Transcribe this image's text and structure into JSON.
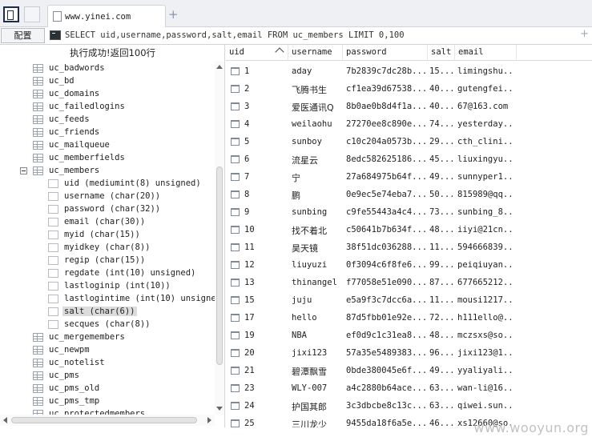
{
  "tabbar": {
    "tab_title": "www.yinei.com",
    "new_tab_symbol": "+"
  },
  "toolbar": {
    "config_label": "配置",
    "sql": "SELECT uid,username,password,salt,email FROM uc_members LIMIT 0,100",
    "corner_symbol": "+"
  },
  "left_panel": {
    "status": "执行成功!返回100行",
    "tree": [
      {
        "label": "uc_badwords",
        "level": 0,
        "kind": "table"
      },
      {
        "label": "uc_bd",
        "level": 0,
        "kind": "table"
      },
      {
        "label": "uc_domains",
        "level": 0,
        "kind": "table"
      },
      {
        "label": "uc_failedlogins",
        "level": 0,
        "kind": "table"
      },
      {
        "label": "uc_feeds",
        "level": 0,
        "kind": "table"
      },
      {
        "label": "uc_friends",
        "level": 0,
        "kind": "table"
      },
      {
        "label": "uc_mailqueue",
        "level": 0,
        "kind": "table"
      },
      {
        "label": "uc_memberfields",
        "level": 0,
        "kind": "table"
      },
      {
        "label": "uc_members",
        "level": 0,
        "kind": "table",
        "expanded": true
      },
      {
        "label": "uid (mediumint(8) unsigned)",
        "level": 1,
        "kind": "column"
      },
      {
        "label": "username (char(20))",
        "level": 1,
        "kind": "column"
      },
      {
        "label": "password (char(32))",
        "level": 1,
        "kind": "column"
      },
      {
        "label": "email (char(30))",
        "level": 1,
        "kind": "column"
      },
      {
        "label": "myid (char(15))",
        "level": 1,
        "kind": "column"
      },
      {
        "label": "myidkey (char(8))",
        "level": 1,
        "kind": "column"
      },
      {
        "label": "regip (char(15))",
        "level": 1,
        "kind": "column"
      },
      {
        "label": "regdate (int(10) unsigned)",
        "level": 1,
        "kind": "column"
      },
      {
        "label": "lastloginip (int(10))",
        "level": 1,
        "kind": "column"
      },
      {
        "label": "lastlogintime (int(10) unsigned",
        "level": 1,
        "kind": "column"
      },
      {
        "label": "salt (char(6))",
        "level": 1,
        "kind": "column",
        "selected": true
      },
      {
        "label": "secques (char(8))",
        "level": 1,
        "kind": "column"
      },
      {
        "label": "uc_mergemembers",
        "level": 0,
        "kind": "table"
      },
      {
        "label": "uc_newpm",
        "level": 0,
        "kind": "table"
      },
      {
        "label": "uc_notelist",
        "level": 0,
        "kind": "table"
      },
      {
        "label": "uc_pms",
        "level": 0,
        "kind": "table"
      },
      {
        "label": "uc_pms_old",
        "level": 0,
        "kind": "table"
      },
      {
        "label": "uc_pms_tmp",
        "level": 0,
        "kind": "table"
      },
      {
        "label": "uc_protectedmembers",
        "level": 0,
        "kind": "table"
      }
    ]
  },
  "grid": {
    "columns": [
      "uid",
      "username",
      "password",
      "salt",
      "email"
    ],
    "rows": [
      {
        "uid": "1",
        "username": "aday",
        "password": "7b2839c7dc28b...",
        "salt": "15...",
        "email": "limingshu..."
      },
      {
        "uid": "2",
        "username": "飞腾书生",
        "password": "cf1ea39d67538...",
        "salt": "40...",
        "email": "gutengfei..."
      },
      {
        "uid": "3",
        "username": "爱医通讯Q",
        "password": "8b0ae0b8d4f1a...",
        "salt": "40...",
        "email": "67@163.com"
      },
      {
        "uid": "4",
        "username": "weilaohu",
        "password": "27270ee8c890e...",
        "salt": "74...",
        "email": "yesterday..."
      },
      {
        "uid": "5",
        "username": "sunboy",
        "password": "c10c204a0573b...",
        "salt": "29...",
        "email": "cth_clini..."
      },
      {
        "uid": "6",
        "username": "流星云",
        "password": "8edc582625186...",
        "salt": "45...",
        "email": "liuxingyu..."
      },
      {
        "uid": "7",
        "username": "宁",
        "password": "27a684975b64f...",
        "salt": "49...",
        "email": "sunnyper1..."
      },
      {
        "uid": "8",
        "username": "鹏",
        "password": "0e9ec5e74eba7...",
        "salt": "50...",
        "email": "815989@qq..."
      },
      {
        "uid": "9",
        "username": "sunbing",
        "password": "c9fe55443a4c4...",
        "salt": "73...",
        "email": "sunbing_8..."
      },
      {
        "uid": "10",
        "username": "找不着北",
        "password": "c50641b7b634f...",
        "salt": "48...",
        "email": "iiyi@21cn..."
      },
      {
        "uid": "11",
        "username": "昊天镜",
        "password": "38f51dc036288...",
        "salt": "11...",
        "email": "594666839..."
      },
      {
        "uid": "12",
        "username": "liuyuzi",
        "password": "0f3094c6f8fe6...",
        "salt": "99...",
        "email": "peiqiuyan..."
      },
      {
        "uid": "13",
        "username": "thinangel",
        "password": "f77058e51e090...",
        "salt": "87...",
        "email": "677665212..."
      },
      {
        "uid": "15",
        "username": "juju",
        "password": "e5a9f3c7dcc6a...",
        "salt": "11...",
        "email": "mousi1217..."
      },
      {
        "uid": "17",
        "username": "hello",
        "password": "87d5fbb01e92e...",
        "salt": "72...",
        "email": "h111ello@..."
      },
      {
        "uid": "19",
        "username": "NBA",
        "password": "ef0d9c1c31ea8...",
        "salt": "48...",
        "email": "mczsxs@so..."
      },
      {
        "uid": "20",
        "username": "jixi123",
        "password": "57a35e5489383...",
        "salt": "96...",
        "email": "jixi123@1..."
      },
      {
        "uid": "21",
        "username": "碧潭飘雪",
        "password": "0bde380045e6f...",
        "salt": "49...",
        "email": "yyaliyali..."
      },
      {
        "uid": "23",
        "username": "WLY-007",
        "password": "a4c2880b64ace...",
        "salt": "63...",
        "email": "wan-li@16..."
      },
      {
        "uid": "24",
        "username": "护国其郎",
        "password": "3c3dbcbe8c13c...",
        "salt": "63...",
        "email": "qiwei.sun..."
      },
      {
        "uid": "25",
        "username": "三川龙少",
        "password": "9455da18f6a5e...",
        "salt": "46...",
        "email": "xs12660@so..."
      }
    ]
  },
  "watermark": "www.wooyun.org"
}
